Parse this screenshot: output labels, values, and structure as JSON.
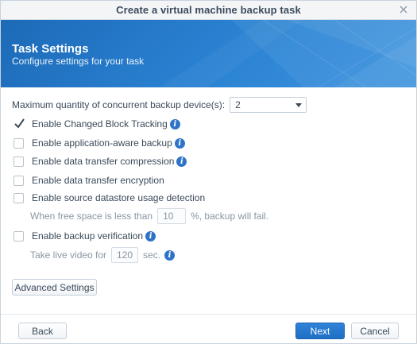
{
  "window": {
    "title": "Create a virtual machine backup task"
  },
  "banner": {
    "title": "Task Settings",
    "subtitle": "Configure settings for your task"
  },
  "concurrent": {
    "label": "Maximum quantity of concurrent backup device(s):",
    "value": "2"
  },
  "options": [
    {
      "label": "Enable Changed Block Tracking",
      "checked": true,
      "info": true
    },
    {
      "label": "Enable application-aware backup",
      "checked": false,
      "info": true
    },
    {
      "label": "Enable data transfer compression",
      "checked": false,
      "info": true
    },
    {
      "label": "Enable data transfer encryption",
      "checked": false,
      "info": false
    },
    {
      "label": "Enable source datastore usage detection",
      "checked": false,
      "info": false
    },
    {
      "label": "Enable backup verification",
      "checked": false,
      "info": true
    }
  ],
  "free_space": {
    "prefix": "When free space is less than",
    "value": "10",
    "suffix": "%, backup will fail."
  },
  "live_video": {
    "prefix": "Take live video for",
    "value": "120",
    "suffix": "sec."
  },
  "buttons": {
    "advanced": "Advanced Settings",
    "back": "Back",
    "next": "Next",
    "cancel": "Cancel"
  },
  "colors": {
    "accent": "#2b83d3",
    "info": "#2f73c8"
  }
}
